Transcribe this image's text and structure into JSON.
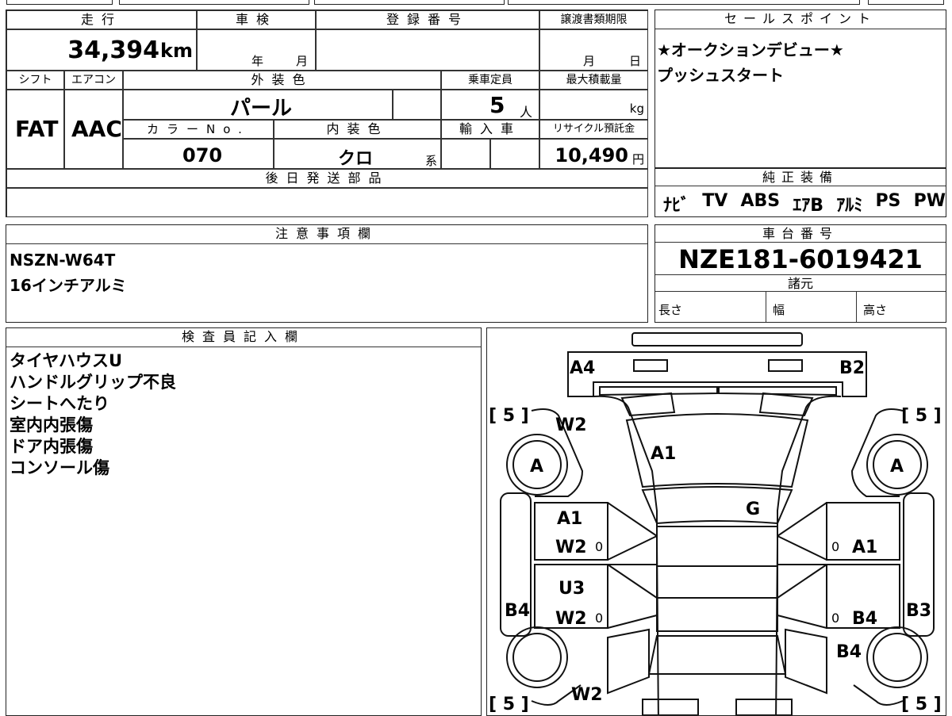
{
  "top_table": {
    "mileage_label": "走行",
    "mileage_value": "34,394",
    "mileage_unit": "km",
    "inspection_label": "車検",
    "inspection_year": "年",
    "inspection_month": "月",
    "reg_label": "登録番号",
    "transfer_label": "譲渡書類期限",
    "transfer_month": "月",
    "transfer_day": "日",
    "shift_label": "シフト",
    "shift_value": "FAT",
    "ac_label": "エアコン",
    "ac_value": "AAC",
    "exterior_label": "外装色",
    "exterior_value": "パール",
    "capacity_label": "乗車定員",
    "capacity_value": "5",
    "capacity_unit": "人",
    "maxload_label": "最大積載量",
    "maxload_unit": "kg",
    "colorno_label": "カラーNo.",
    "colorno_value": "070",
    "interior_label": "内装色",
    "interior_value": "クロ",
    "interior_unit": "系",
    "import_label": "輸入車",
    "recycle_label": "リサイクル預託金",
    "recycle_value": "10,490",
    "recycle_unit": "円",
    "later_label": "後日発送部品"
  },
  "sales": {
    "label": "セールスポイント",
    "lines": [
      "★オークションデビュー★",
      "プッシュスタート"
    ]
  },
  "equipment": {
    "label": "純正装備",
    "items": [
      "ﾅﾋﾞ",
      "TV",
      "ABS",
      "ｴｱB",
      "ｱﾙﾐ",
      "PS",
      "PW"
    ]
  },
  "notes": {
    "label": "注意事項欄",
    "lines": [
      "NSZN-W64T",
      "16インチアルミ"
    ]
  },
  "chassis": {
    "label": "車台番号",
    "value": "NZE181-6019421",
    "spec_label": "諸元",
    "length_label": "長さ",
    "width_label": "幅",
    "height_label": "高さ"
  },
  "inspector": {
    "label": "検査員記入欄",
    "lines": [
      "タイヤハウスU",
      "ハンドルグリップ不良",
      "シートへたり",
      "室内内張傷",
      "ドア内張傷",
      "コンソール傷"
    ]
  },
  "diagram": {
    "a4": "A4",
    "b2": "B2",
    "w2_front_left": "W2",
    "a1_hood": "A1",
    "g_windshield": "G",
    "tire_left": "A",
    "tire_right": "A",
    "bracket_tl": "[ 5 ]",
    "bracket_tr": "[ 5 ]",
    "bracket_bl": "[ 5 ]",
    "bracket_br": "[ 5 ]",
    "fl_door_1": "A1",
    "fl_door_2": "W2",
    "fl_door_0": "0",
    "fr_door_1": "A1",
    "fr_door_0": "0",
    "rl_door_1": "U3",
    "rl_door_2": "W2",
    "rl_door_0": "0",
    "rr_door_1": "B4",
    "rr_door_0": "0",
    "b4_left": "B4",
    "b3_right": "B3",
    "b4_right_rear": "B4",
    "w2_rear_left": "W2"
  }
}
